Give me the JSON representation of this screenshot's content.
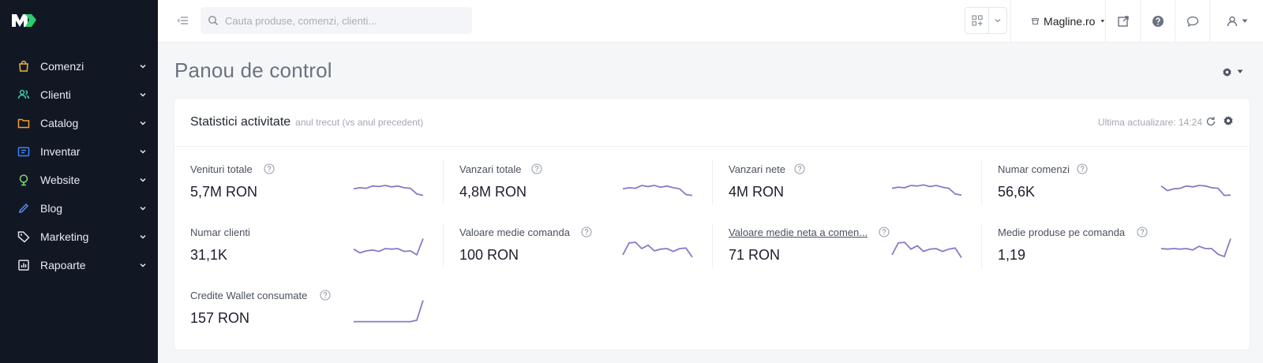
{
  "brand": {
    "accent": "#8c78c8",
    "sidebar_bg": "#121724",
    "logo_colors": [
      "#ffffff",
      "#2ecc71"
    ]
  },
  "sidebar": {
    "items": [
      {
        "label": "Comenzi",
        "icon": "shopping-bag-icon",
        "color": "#f0b23e"
      },
      {
        "label": "Clienti",
        "icon": "users-icon",
        "color": "#3cc9a6"
      },
      {
        "label": "Catalog",
        "icon": "folder-icon",
        "color": "#f0a030"
      },
      {
        "label": "Inventar",
        "icon": "inventory-icon",
        "color": "#3b82f6"
      },
      {
        "label": "Website",
        "icon": "globe-icon",
        "color": "#7dd96b"
      },
      {
        "label": "Blog",
        "icon": "pencil-icon",
        "color": "#5b8cf0"
      },
      {
        "label": "Marketing",
        "icon": "tag-icon",
        "color": "#dfe3ea"
      },
      {
        "label": "Rapoarte",
        "icon": "report-icon",
        "color": "#dfe3ea"
      }
    ]
  },
  "topbar": {
    "search_placeholder": "Cauta produse, comenzi, clienti...",
    "store_label": "Magline.ro"
  },
  "page": {
    "title": "Panou de control"
  },
  "card": {
    "title": "Statistici activitate",
    "subtitle": "anul trecut (vs anul precedent)",
    "last_update": "Ultima actualizare: 14:24"
  },
  "stats": [
    {
      "label": "Venituri totale",
      "value": "5,7M RON",
      "trend": [
        0.62,
        0.58,
        0.6,
        0.52,
        0.54,
        0.5,
        0.55,
        0.52,
        0.58,
        0.6,
        0.8,
        0.85
      ],
      "underline": false
    },
    {
      "label": "Vanzari totale",
      "value": "4,8M RON",
      "trend": [
        0.62,
        0.58,
        0.6,
        0.5,
        0.54,
        0.5,
        0.56,
        0.52,
        0.58,
        0.62,
        0.82,
        0.85
      ],
      "underline": false
    },
    {
      "label": "Vanzari nete",
      "value": "4M RON",
      "trend": [
        0.6,
        0.56,
        0.58,
        0.5,
        0.52,
        0.48,
        0.54,
        0.5,
        0.56,
        0.6,
        0.8,
        0.84
      ],
      "underline": false
    },
    {
      "label": "Numar comenzi",
      "value": "56,6K",
      "trend": [
        0.52,
        0.68,
        0.62,
        0.6,
        0.52,
        0.55,
        0.5,
        0.52,
        0.58,
        0.6,
        0.85,
        0.84
      ],
      "underline": false
    },
    {
      "label": "Numar clienti",
      "value": "31,1K",
      "trend": [
        0.52,
        0.65,
        0.58,
        0.55,
        0.6,
        0.5,
        0.52,
        0.5,
        0.6,
        0.58,
        0.72,
        0.15
      ],
      "underline": false
    },
    {
      "label": "Valoare medie comanda",
      "value": "100 RON",
      "trend": [
        0.72,
        0.3,
        0.28,
        0.5,
        0.38,
        0.58,
        0.52,
        0.5,
        0.6,
        0.5,
        0.48,
        0.8
      ],
      "underline": false
    },
    {
      "label": "Valoare medie neta a comen...",
      "value": "71 RON",
      "trend": [
        0.72,
        0.3,
        0.28,
        0.52,
        0.4,
        0.6,
        0.52,
        0.5,
        0.6,
        0.52,
        0.48,
        0.82
      ],
      "underline": true
    },
    {
      "label": "Medie produse pe comanda",
      "value": "1,19",
      "trend": [
        0.5,
        0.52,
        0.5,
        0.52,
        0.5,
        0.55,
        0.42,
        0.5,
        0.5,
        0.7,
        0.78,
        0.15
      ],
      "underline": false
    },
    {
      "label": "Credite Wallet consumate",
      "value": "157 RON",
      "trend": [
        0.85,
        0.85,
        0.85,
        0.85,
        0.85,
        0.85,
        0.85,
        0.85,
        0.85,
        0.85,
        0.8,
        0.1
      ],
      "underline": false
    }
  ]
}
